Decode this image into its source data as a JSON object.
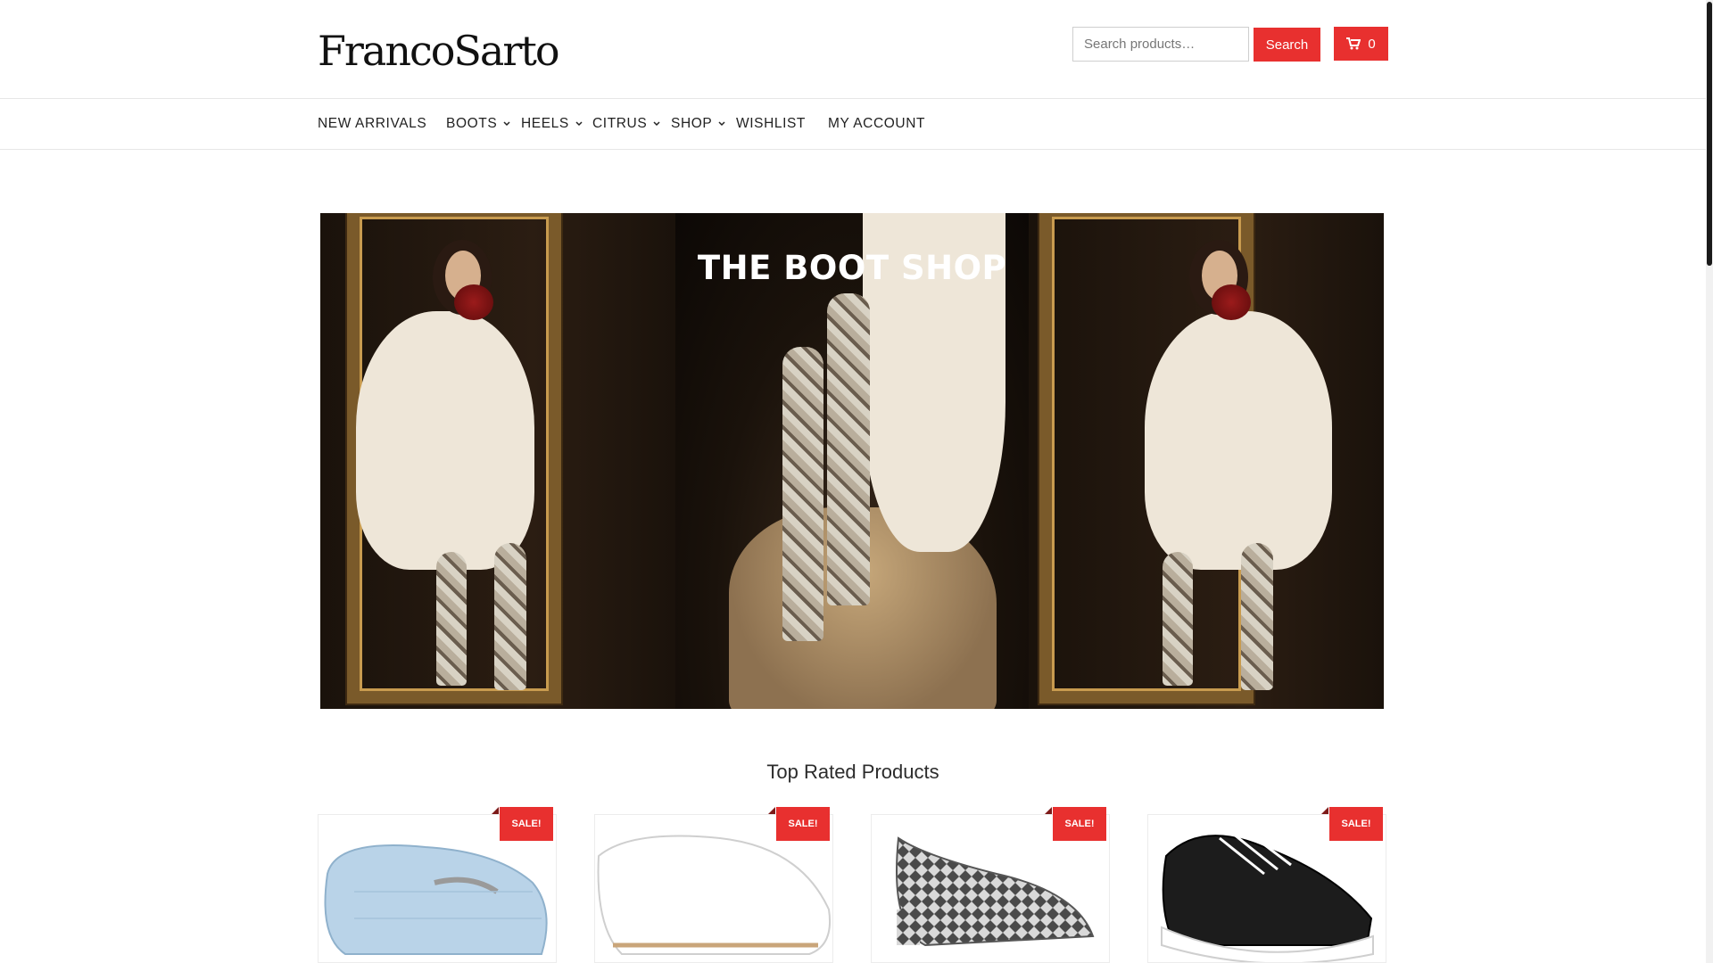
{
  "header": {
    "logo_text": "FrancoSarto",
    "search_placeholder": "Search products…",
    "search_button": "Search",
    "cart_count": "0"
  },
  "nav": {
    "items": [
      {
        "label": "NEW ARRIVALS",
        "has_dropdown": false
      },
      {
        "label": "BOOTS",
        "has_dropdown": true
      },
      {
        "label": "HEELS",
        "has_dropdown": true
      },
      {
        "label": "CITRUS",
        "has_dropdown": true
      },
      {
        "label": "SHOP",
        "has_dropdown": true
      },
      {
        "label": "WISHLIST",
        "has_dropdown": false
      },
      {
        "label": "MY ACCOUNT",
        "has_dropdown": false
      }
    ]
  },
  "hero": {
    "title": "THE BOOT SHOP"
  },
  "section": {
    "title": "Top Rated Products"
  },
  "products": [
    {
      "badge": "SALE!",
      "color": "#b9d3e8"
    },
    {
      "badge": "SALE!",
      "color": "#ffffff"
    },
    {
      "badge": "SALE!",
      "color": "#8a8a8a"
    },
    {
      "badge": "SALE!",
      "color": "#1c1c1c"
    }
  ],
  "colors": {
    "accent": "#e8302f"
  }
}
